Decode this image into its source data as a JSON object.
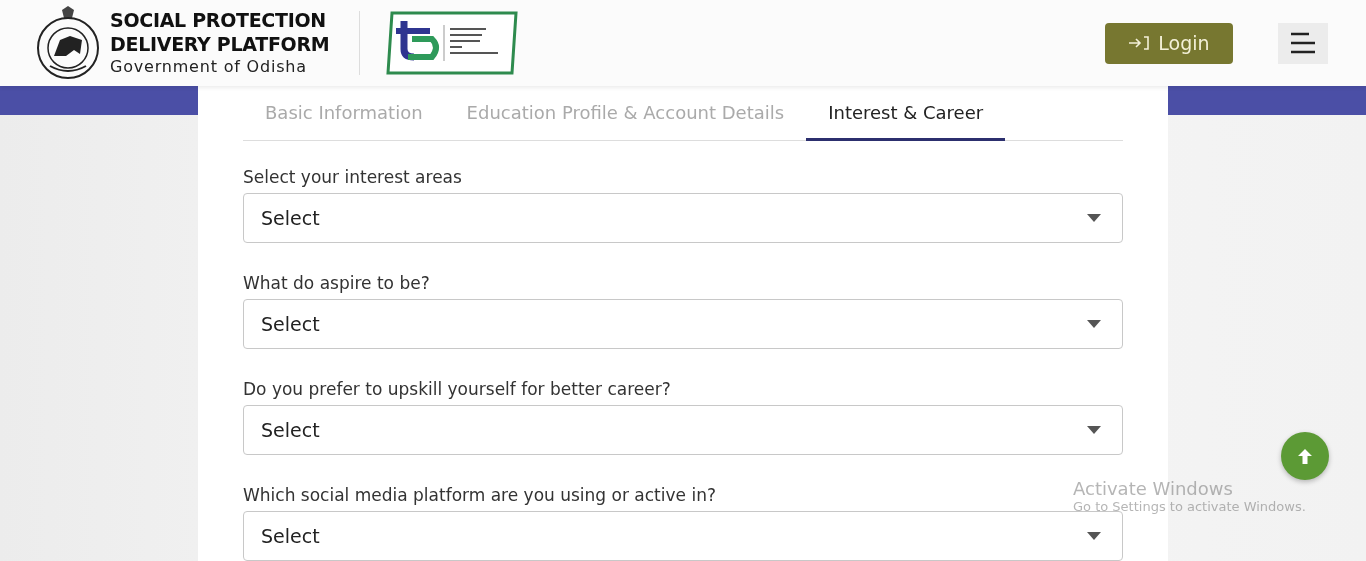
{
  "header": {
    "title_lines": [
      "SOCIAL PROTECTION",
      "DELIVERY PLATFORM"
    ],
    "subtitle": "Government of Odisha",
    "login": {
      "label": "Login"
    }
  },
  "tabs": [
    {
      "label": "Basic Information",
      "selected": false
    },
    {
      "label": "Education Profile & Account Details",
      "selected": false
    },
    {
      "label": "Interest & Career",
      "selected": true
    }
  ],
  "questions": [
    {
      "label": "Select your interest areas",
      "placeholder": "Select"
    },
    {
      "label": "What do aspire to be?",
      "placeholder": "Select"
    },
    {
      "label": "Do you prefer to upskill yourself for better career?",
      "placeholder": "Select"
    },
    {
      "label": "Which social media platform are you using or active in?",
      "placeholder": "Select"
    }
  ],
  "os_notice": {
    "title": "Activate Windows",
    "text": "Go to Settings to activate Windows."
  }
}
